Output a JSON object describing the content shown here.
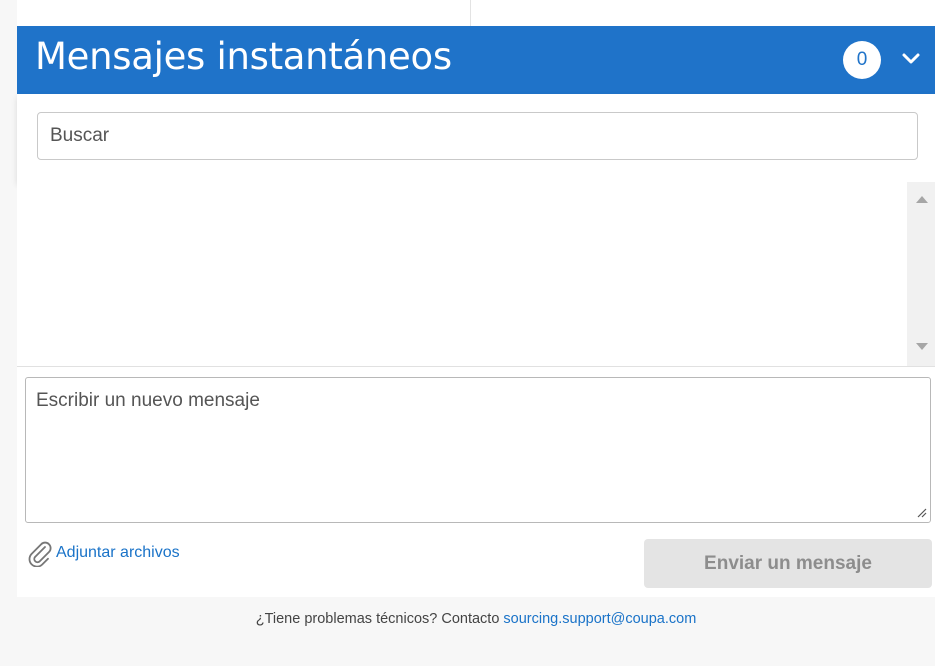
{
  "chat": {
    "title": "Mensajes instantáneos",
    "unread_count": "0",
    "search_placeholder": "Buscar",
    "message_placeholder": "Escribir un nuevo mensaje",
    "attach_label": "Adjuntar archivos",
    "send_label": "Enviar un mensaje",
    "send_enabled": false
  },
  "footer": {
    "text": "¿Tiene problemas técnicos? Contacto",
    "email": "sourcing.support@coupa.com"
  },
  "colors": {
    "header_bg": "#1f73c9",
    "link": "#1a73c8",
    "send_disabled_bg": "#e4e4e4"
  },
  "icons": {
    "collapse": "chevron-down-icon",
    "attach": "paperclip-icon",
    "scroll_up": "arrow-up-icon",
    "scroll_down": "arrow-down-icon"
  }
}
